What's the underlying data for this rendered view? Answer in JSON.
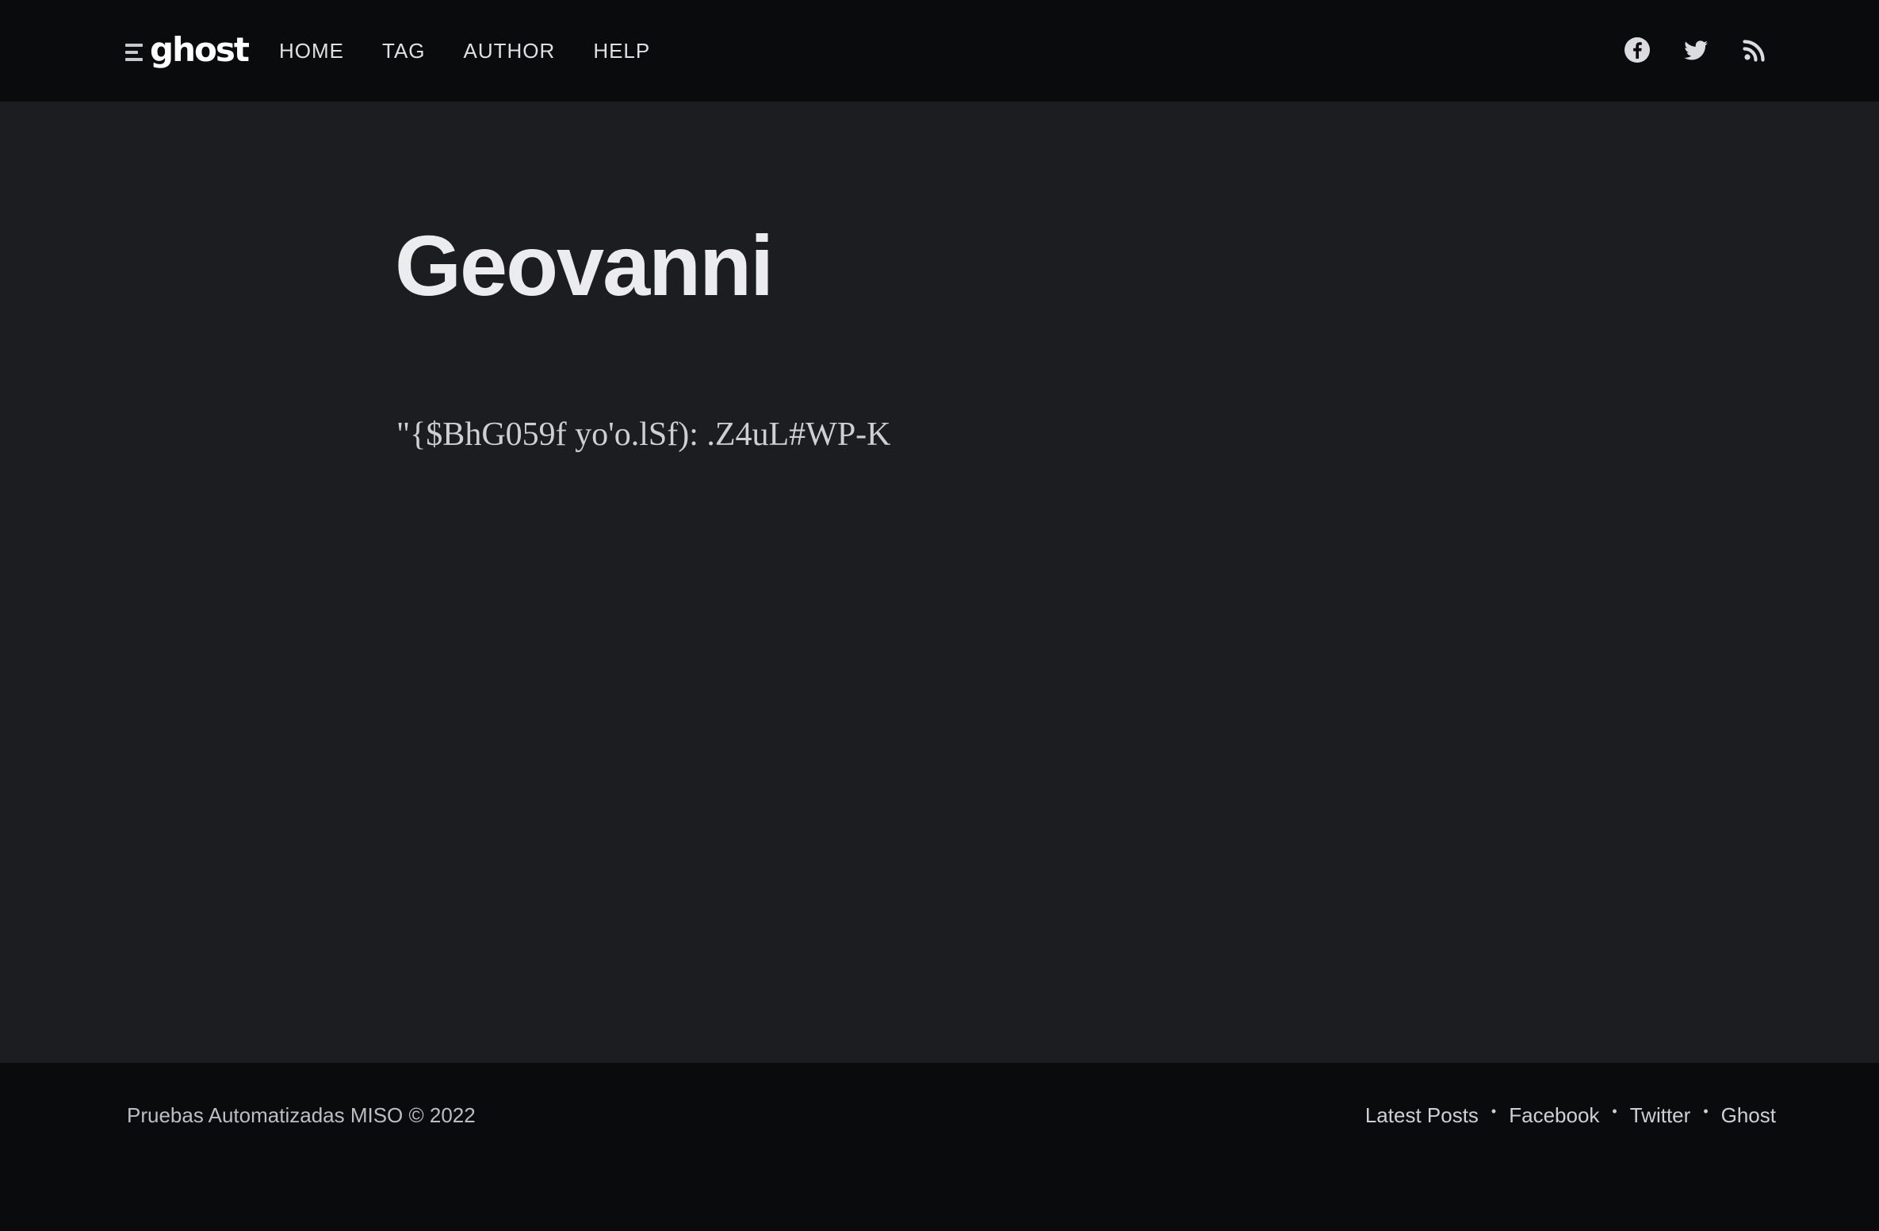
{
  "header": {
    "logo_text": "ghost",
    "nav": [
      "HOME",
      "TAG",
      "AUTHOR",
      "HELP"
    ],
    "social": {
      "facebook_icon": "facebook-icon",
      "twitter_icon": "twitter-icon",
      "rss_icon": "rss-icon"
    }
  },
  "author": {
    "name": "Geovanni",
    "bio": "\"{$BhG059f yo'o.lSf): .Z4uL#WP-K"
  },
  "footer": {
    "copyright": "Pruebas Automatizadas MISO © 2022",
    "links": [
      "Latest Posts",
      "Facebook",
      "Twitter",
      "Ghost"
    ],
    "separator": "•"
  },
  "colors": {
    "header_bg": "#0a0b0d",
    "page_bg": "#1c1d21",
    "text": "#e6e6e8"
  }
}
